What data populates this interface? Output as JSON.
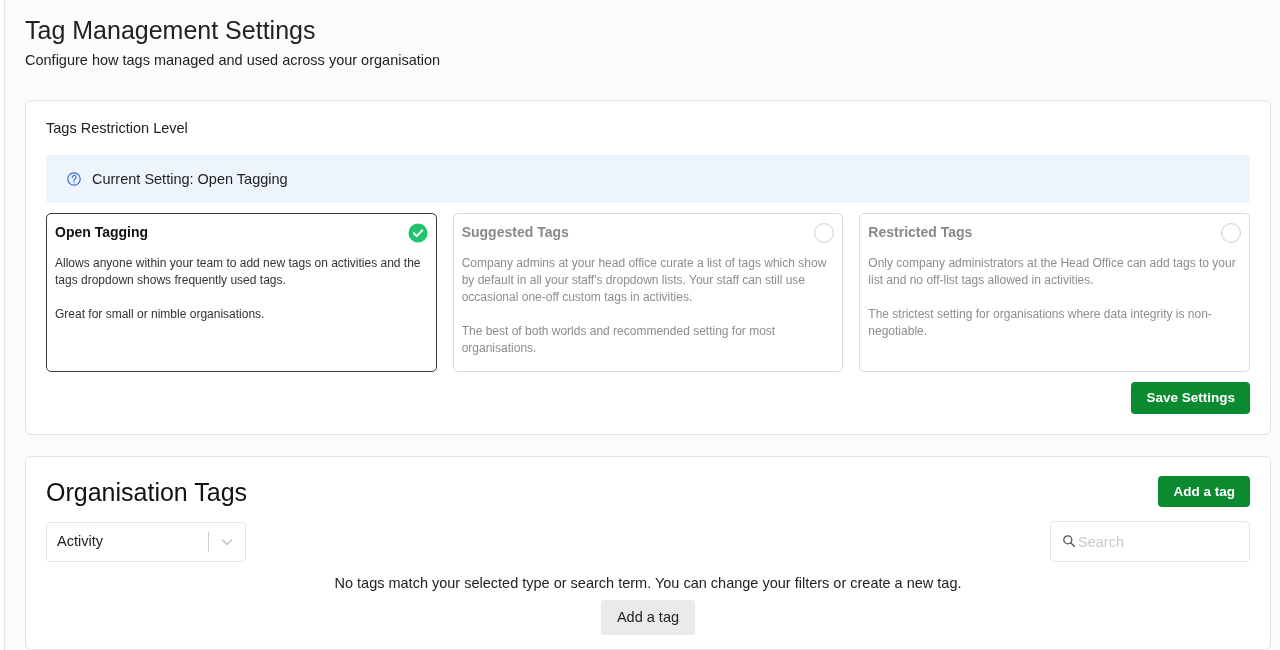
{
  "page": {
    "title": "Tag Management Settings",
    "subtitle": "Configure how tags managed and used across your organisation"
  },
  "restriction": {
    "heading": "Tags Restriction Level",
    "current_setting": "Current Setting: Open Tagging",
    "options": [
      {
        "title": "Open Tagging",
        "description": [
          "Allows anyone within your team to add new tags on activities and the tags dropdown shows frequently used tags.",
          "Great for small or nimble organisations."
        ],
        "selected": true
      },
      {
        "title": "Suggested Tags",
        "description": [
          "Company admins at your head office curate a list of tags which show by default in all your staff's dropdown lists. Your staff can still use occasional one-off custom tags in activities.",
          "The best of both worlds and recommended setting for most organisations."
        ],
        "selected": false
      },
      {
        "title": "Restricted Tags",
        "description": [
          "Only company administrators at the Head Office can add tags to your list and no off-list tags allowed in activities.",
          "The strictest setting for organisations where data integrity is non-negotiable."
        ],
        "selected": false
      }
    ],
    "save_button": "Save Settings"
  },
  "organisation_tags": {
    "title": "Organisation Tags",
    "add_button": "Add a tag",
    "type_filter": {
      "value": "Activity"
    },
    "search": {
      "placeholder": "Search"
    },
    "empty_message": "No tags match your selected type or search term. You can change your filters or create a new tag.",
    "empty_add_button": "Add a tag"
  }
}
